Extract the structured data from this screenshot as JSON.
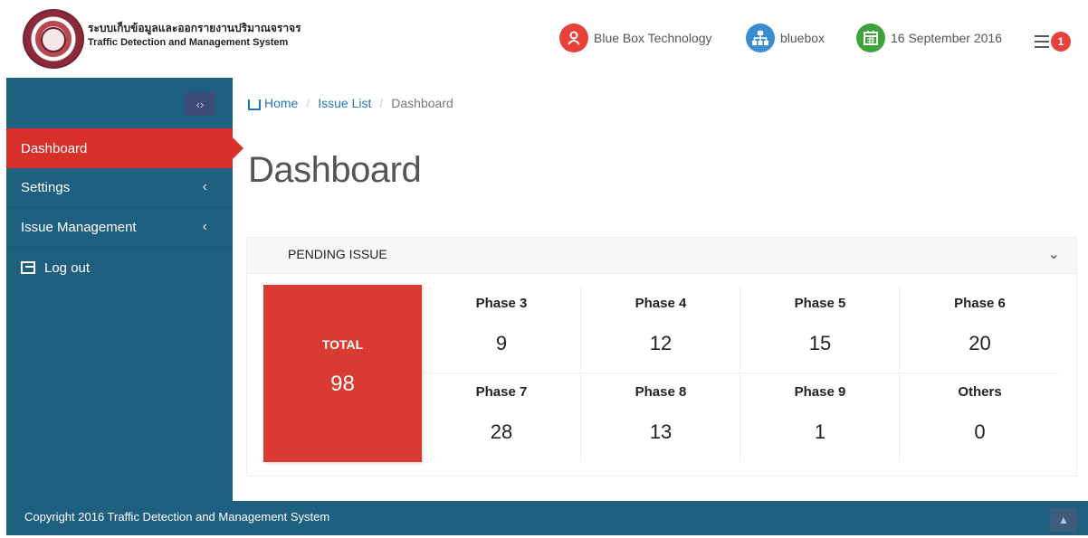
{
  "header": {
    "brand_thai": "ระบบเก็บข้อมูลและออกรายงานปริมาณจราจร",
    "brand_en": "Traffic Detection and Management System",
    "user_name": "Blue Box Technology",
    "org_name": "bluebox",
    "date": "16 September 2016",
    "notification_count": "1",
    "user_icon": "user-icon",
    "org_icon": "sitemap-icon",
    "date_icon": "calendar-icon",
    "notification_icon": "list-icon",
    "accent_colors": {
      "user": "#e8413a",
      "org": "#3a8ed0",
      "date": "#3ea33a"
    }
  },
  "sidebar": {
    "toggle_glyph": "‹›",
    "items": [
      {
        "label": "Dashboard",
        "active": true
      },
      {
        "label": "Settings",
        "has_submenu": true
      },
      {
        "label": "Issue Management",
        "has_submenu": true
      },
      {
        "label": "Log out",
        "icon": "logout-icon"
      }
    ],
    "submenu_glyph": "‹",
    "bg_color": "#1f5f80",
    "active_color": "#d9302b"
  },
  "breadcrumb": {
    "home": "Home",
    "issue_list": "Issue List",
    "current": "Dashboard",
    "separator": "/"
  },
  "page": {
    "title": "Dashboard"
  },
  "panel": {
    "title": "PENDING ISSUE",
    "collapse_glyph": "⌄",
    "total": {
      "label": "TOTAL",
      "value": "98"
    },
    "phases": [
      {
        "label": "Phase 3",
        "value": "9"
      },
      {
        "label": "Phase 4",
        "value": "12"
      },
      {
        "label": "Phase 5",
        "value": "15"
      },
      {
        "label": "Phase 6",
        "value": "20"
      },
      {
        "label": "Phase 7",
        "value": "28"
      },
      {
        "label": "Phase 8",
        "value": "13"
      },
      {
        "label": "Phase 9",
        "value": "1"
      },
      {
        "label": "Others",
        "value": "0"
      }
    ]
  },
  "footer": {
    "copyright": "Copyright 2016 Traffic Detection and Management System",
    "back_to_top_glyph": "▲"
  }
}
